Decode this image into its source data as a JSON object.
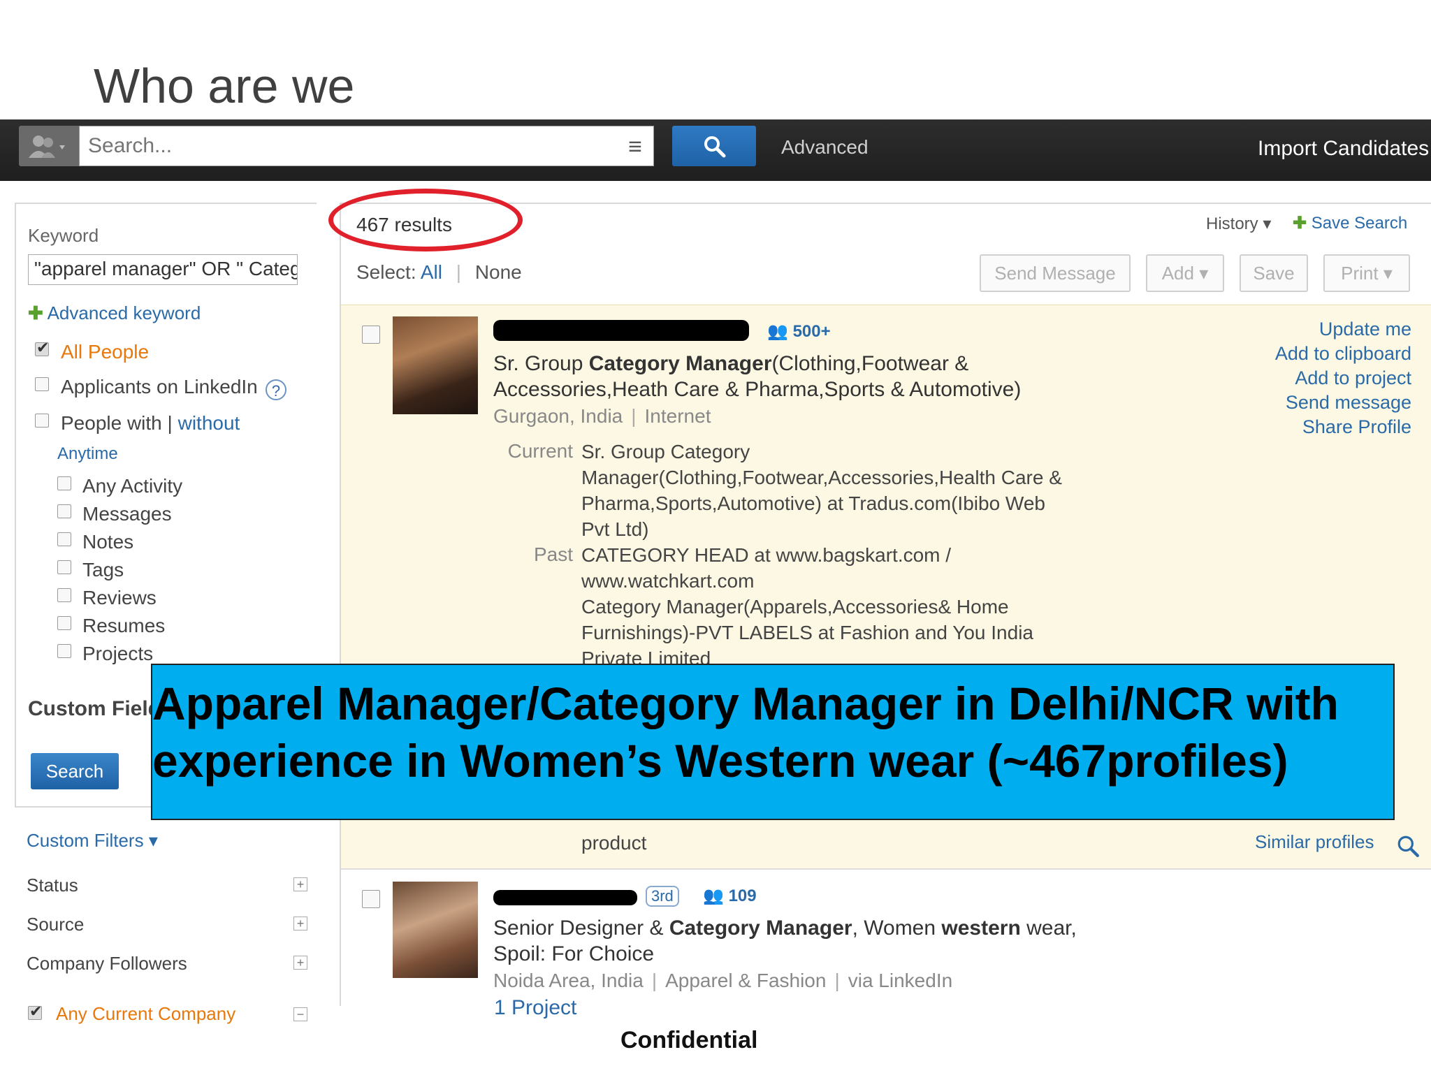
{
  "slide": {
    "title": "Who are we",
    "footer": "Confidential"
  },
  "topbar": {
    "search_placeholder": "Search...",
    "advanced_label": "Advanced",
    "import_label": "Import Candidates"
  },
  "sidebar": {
    "keyword_label": "Keyword",
    "keyword_value": "\"apparel manager\" OR \" Category",
    "advanced_keyword": "Advanced keyword",
    "all_people": "All People",
    "applicants": "Applicants on LinkedIn",
    "help_glyph": "?",
    "people_with": "People with",
    "with_sep": "|",
    "without": "without",
    "anytime": "Anytime",
    "activity_options": [
      "Any Activity",
      "Messages",
      "Notes",
      "Tags",
      "Reviews",
      "Resumes",
      "Projects"
    ],
    "custom_fields": "Custom Fields",
    "search_button": "Search",
    "custom_filters": "Custom Filters",
    "filters": [
      "Status",
      "Source",
      "Company Followers"
    ],
    "any_current_company": "Any Current Company"
  },
  "results": {
    "count_text": "467 results",
    "history": "History",
    "save_search": "Save Search",
    "select_label": "Select:",
    "select_all": "All",
    "select_none": "None",
    "toolbar": [
      "Send Message",
      "Add",
      "Save",
      "Print"
    ]
  },
  "profile1": {
    "connections": "500+",
    "headline_1": "Sr. Group",
    "headline_bold_1": "Category Manager",
    "headline_2": "(Clothing,Footwear & Accessories,Heath Care & Pharma,Sports & Automotive)",
    "location": "Gurgaon, India",
    "industry": "Internet",
    "current_label": "Current",
    "current_lines": [
      "Sr. Group Category",
      "Manager(Clothing,Footwear,Accessories,Health Care &",
      "Pharma,Sports,Automotive) at Tradus.com(Ibibo Web",
      "Pvt Ltd)"
    ],
    "past_label": "Past",
    "past_lines": [
      "CATEGORY HEAD at www.bagskart.com /",
      "www.watchkart.com",
      "Category Manager(Apparels,Accessories& Home",
      "Furnishings)-PVT LABELS at Fashion and You India",
      "Private Limited"
    ],
    "last_line": "product",
    "actions": [
      "Update me",
      "Add to clipboard",
      "Add to project",
      "Send message",
      "Share Profile"
    ],
    "similar": "Similar profiles"
  },
  "profile2": {
    "degree": "3rd",
    "connections": "109",
    "headline_1": "Senior Designer &",
    "headline_bold_1": "Category Manager",
    "headline_2": ", Women",
    "headline_bold_2": "western",
    "headline_3": "wear, Spoil: For Choice",
    "location": "Noida Area, India",
    "industry": "Apparel & Fashion",
    "source": "via LinkedIn",
    "projects": "1 Project"
  },
  "banner": {
    "line1": "Apparel Manager/Category Manager in Delhi/NCR with",
    "line2": "experience in Women’s Western wear (~467profiles)",
    "color": "#00aeef"
  }
}
